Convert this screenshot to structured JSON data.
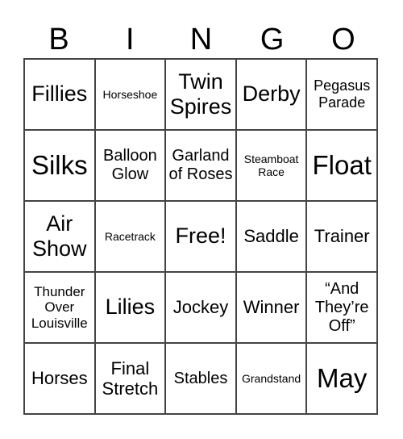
{
  "header": [
    "B",
    "I",
    "N",
    "G",
    "O"
  ],
  "cells": [
    "Fillies",
    "Horseshoe",
    "Twin Spires",
    "Derby",
    "Pegasus Parade",
    "Silks",
    "Balloon Glow",
    "Garland of Roses",
    "Steamboat Race",
    "Float",
    "Air Show",
    "Racetrack",
    "Free!",
    "Saddle",
    "Trainer",
    "Thunder Over Louisville",
    "Lilies",
    "Jockey",
    "Winner",
    "“And They’re Off”",
    "Horses",
    "Final Stretch",
    "Stables",
    "Grandstand",
    "May"
  ]
}
